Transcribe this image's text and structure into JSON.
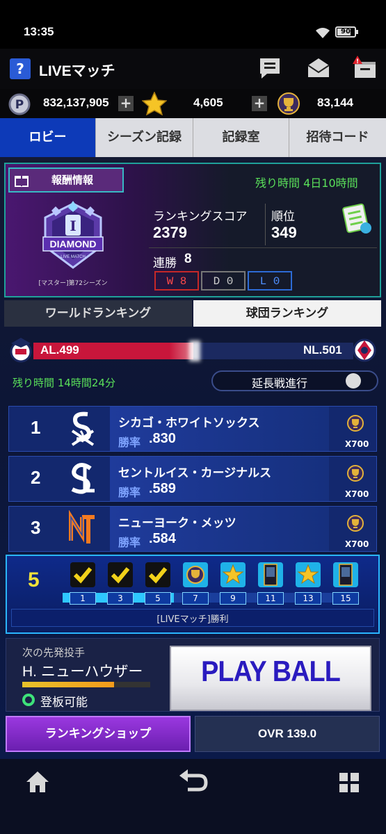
{
  "status_bar": {
    "time": "13:35",
    "battery": "90"
  },
  "header": {
    "title": "LIVEマッチ",
    "help_icon_text": "?"
  },
  "currency": {
    "points": "832,137,905",
    "stars": "4,605",
    "trophies": "83,144",
    "points_icon_text": "P"
  },
  "tabs": [
    {
      "label": "ロビー",
      "active": true
    },
    {
      "label": "シーズン記録",
      "active": false
    },
    {
      "label": "記録室",
      "active": false
    },
    {
      "label": "招待コード",
      "active": false
    }
  ],
  "reward": {
    "button_label": "報酬情報",
    "remaining": "残り時間 4日10時間",
    "badge_title": "DIAMOND",
    "badge_subtitle": "LIVE MATCH",
    "badge_numeral": "I",
    "season": "[マスター]第72シーズン",
    "score_label": "ランキングスコア",
    "score": "2379",
    "rank_label": "順位",
    "rank": "349",
    "streak_label": "連勝",
    "streak": "8",
    "wins": "W 8",
    "draws": "D 0",
    "losses": "L 0"
  },
  "ranking_tabs": [
    {
      "label": "ワールドランキング",
      "active": false
    },
    {
      "label": "球団ランキング",
      "active": true
    }
  ],
  "league": {
    "al_label": "AL.499",
    "nl_label": "NL.501",
    "al_share": 0.499,
    "remaining": "残り時間 14時間24分",
    "extension_label": "延長戦進行",
    "extension_on": false
  },
  "teams": [
    {
      "rank": "1",
      "name": "シカゴ・ホワイトソックス",
      "rate_label": "勝率",
      "rate": ".830",
      "reward": "X700",
      "logo": "white-sox-logo"
    },
    {
      "rank": "2",
      "name": "セントルイス・カージナルス",
      "rate_label": "勝率",
      "rate": ".589",
      "reward": "X700",
      "logo": "cardinals-logo"
    },
    {
      "rank": "3",
      "name": "ニューヨーク・メッツ",
      "rate_label": "勝率",
      "rate": ".584",
      "reward": "X700",
      "logo": "mets-logo"
    }
  ],
  "progress": {
    "count": "5",
    "caption": "[LIVEマッチ]勝利",
    "steps": [
      {
        "num": "1",
        "reward": "check-icon"
      },
      {
        "num": "3",
        "reward": "check-icon"
      },
      {
        "num": "5",
        "reward": "check-icon"
      },
      {
        "num": "7",
        "reward": "trophy-icon"
      },
      {
        "num": "9",
        "reward": "star-icon"
      },
      {
        "num": "11",
        "reward": "card-icon"
      },
      {
        "num": "13",
        "reward": "star-icon"
      },
      {
        "num": "15",
        "reward": "card-icon"
      }
    ]
  },
  "pitcher": {
    "label": "次の先発投手",
    "name": "H. ニューハウザー",
    "stamina": 0.72,
    "status": "登板可能"
  },
  "play_ball": "PLAY BALL",
  "buttons": {
    "shop": "ランキングショップ",
    "ovr": "OVR 139.0"
  },
  "colors": {
    "accent_blue": "#0d3ab8",
    "green_text": "#5ae05a",
    "al_red": "#c8163b",
    "progress_cyan": "#2ec7ff"
  }
}
